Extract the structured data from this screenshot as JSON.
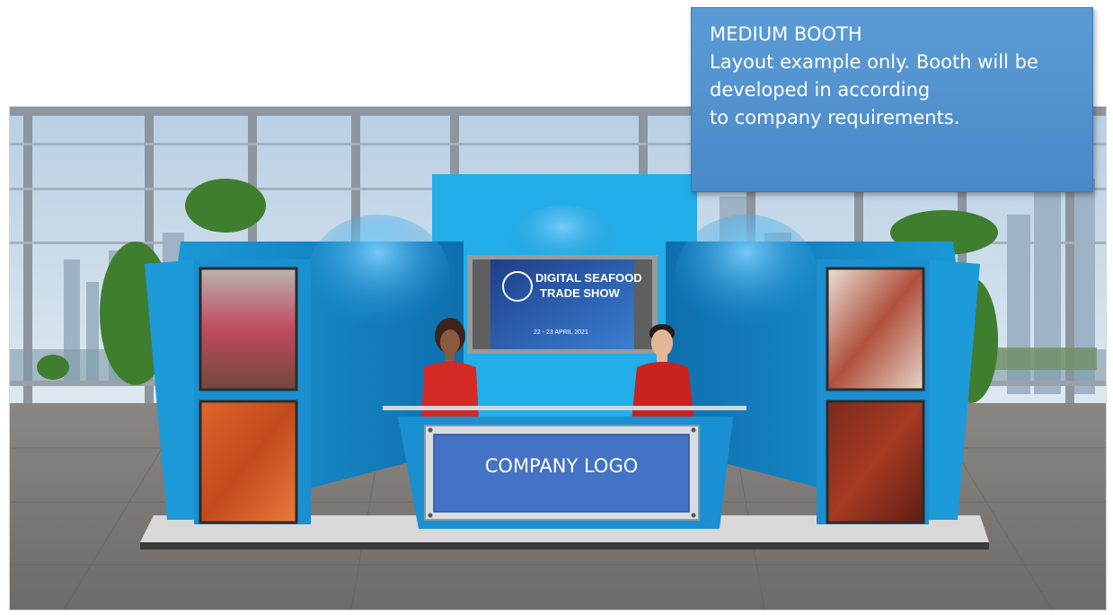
{
  "callout": {
    "title": "MEDIUM BOOTH",
    "line1": "Layout example only. Booth will be",
    "line2": "developed in according",
    "line3": "to company requirements."
  },
  "booth": {
    "logo_label": "COMPANY LOGO",
    "screen_title_1": "DIGITAL SEAFOOD",
    "screen_title_2": "TRADE SHOW",
    "screen_dates": "22 - 23 APRIL 2021"
  },
  "colors": {
    "callout_fill": "#5b9bd5",
    "booth_blue": "#1ea2e0",
    "logo_panel": "#4472c4"
  }
}
